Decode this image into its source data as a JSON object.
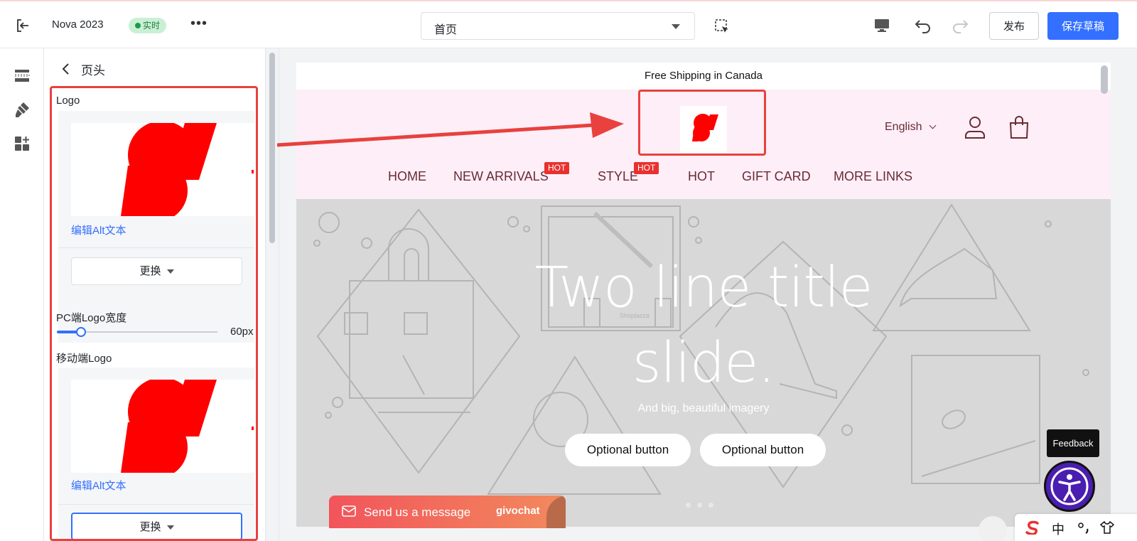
{
  "topbar": {
    "store_name": "Nova 2023",
    "live_badge": "实时",
    "more": "•••",
    "page_select": "首页",
    "publish_label": "发布",
    "save_draft_label": "保存草稿"
  },
  "panel": {
    "title": "页头",
    "logo_label": "Logo",
    "edit_alt_1": "编辑Alt文本",
    "replace_1": "更换",
    "pc_logo_width_label": "PC端Logo宽度",
    "pc_logo_width_value": "60px",
    "pc_logo_width_fraction": 0.15,
    "mobile_logo_label": "移动端Logo",
    "edit_alt_2": "编辑Alt文本",
    "replace_2": "更换"
  },
  "preview": {
    "announcement": "Free Shipping in Canada",
    "language": "English",
    "nav": [
      {
        "label": "HOME",
        "badge": ""
      },
      {
        "label": "NEW ARRIVALS",
        "badge": "HOT"
      },
      {
        "label": "STYLE",
        "badge": "HOT"
      },
      {
        "label": "HOT",
        "badge": ""
      },
      {
        "label": "GIFT CARD",
        "badge": ""
      },
      {
        "label": "MORE LINKS",
        "badge": ""
      }
    ],
    "hero": {
      "title_line1": "Two line title",
      "title_line2": "slide.",
      "subtitle": "And big, beautiful imagery",
      "button1": "Optional button",
      "button2": "Optional button",
      "watermark": "Shoplazza"
    }
  },
  "widgets": {
    "chat_text": "Send us a message",
    "chat_brand": "givochat",
    "feedback": "Feedback",
    "ime_lang": "中"
  },
  "colors": {
    "accent": "#3370ff",
    "highlight": "#e8413e",
    "header_bg": "#fdeef7",
    "nav_text": "#6a2b34",
    "hot_badge": "#e8312f",
    "live_badge_bg": "#c9f0d5"
  }
}
